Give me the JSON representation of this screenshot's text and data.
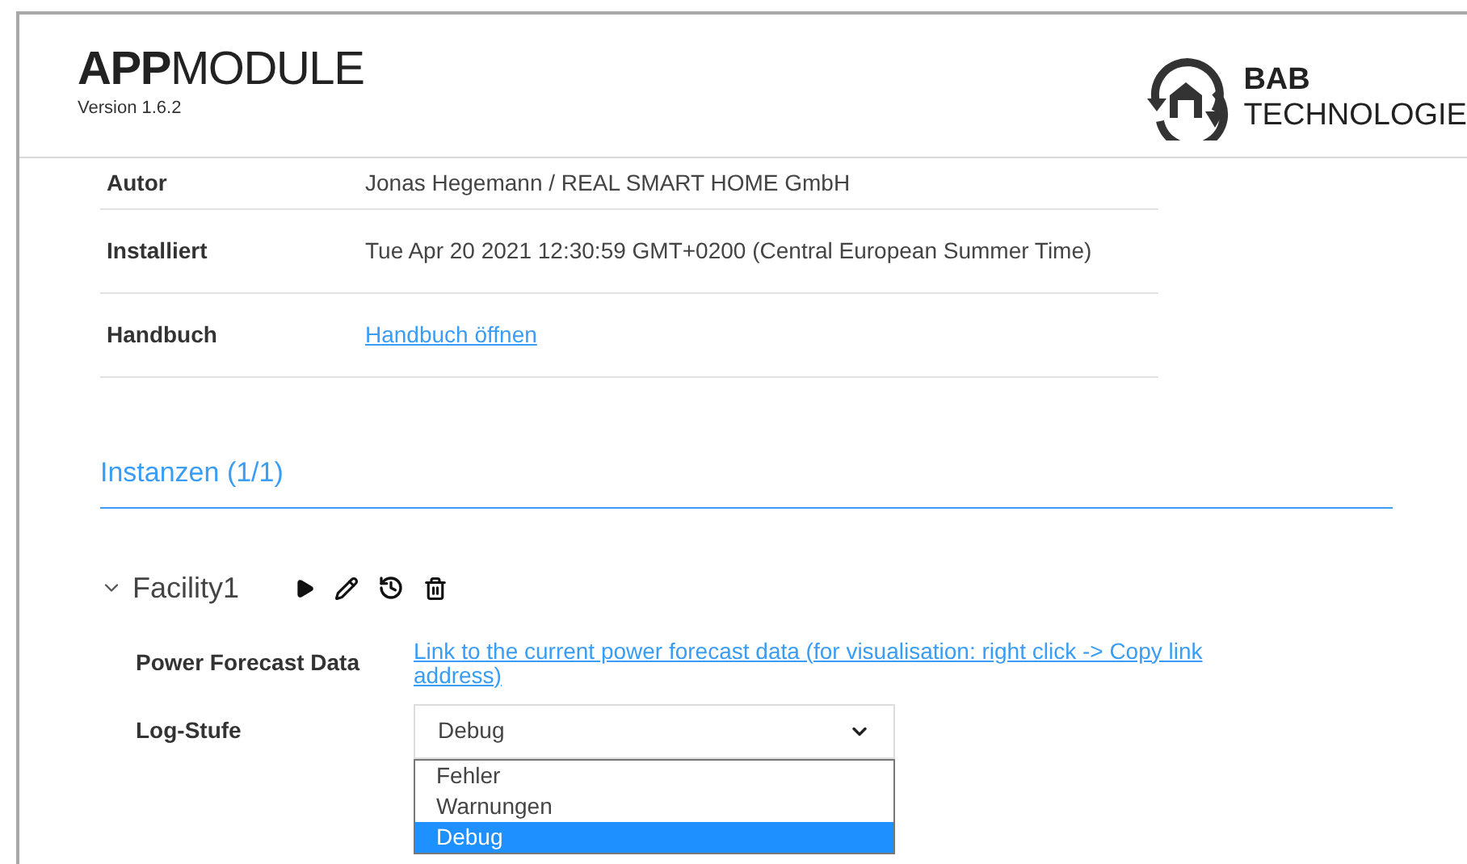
{
  "header": {
    "title_bold": "APP",
    "title_light": "MODULE",
    "version": "Version 1.6.2",
    "logo_line_1": "BAB",
    "logo_line_2": "TECHNOLOGIE"
  },
  "info_rows": [
    {
      "label": "Autor",
      "value": "Jonas Hegemann / REAL SMART HOME GmbH",
      "kind": "text"
    },
    {
      "label": "Installiert",
      "value": "Tue Apr 20 2021 12:30:59 GMT+0200 (Central European Summer Time)",
      "kind": "text"
    },
    {
      "label": "Handbuch",
      "value": "Handbuch öffnen",
      "kind": "link"
    }
  ],
  "instances_heading": "Instanzen (1/1)",
  "instance": {
    "name": "Facility1",
    "expanded": true,
    "fields": [
      {
        "label": "Power Forecast Data",
        "kind": "link",
        "value": "Link to the current power forecast data (for visualisation: right click -> Copy link address)"
      },
      {
        "label": "Log-Stufe",
        "kind": "select",
        "value": "Debug",
        "open": true,
        "options": [
          {
            "label": "Fehler",
            "selected": false
          },
          {
            "label": "Warnungen",
            "selected": false
          },
          {
            "label": "Debug",
            "selected": true
          }
        ]
      }
    ]
  }
}
